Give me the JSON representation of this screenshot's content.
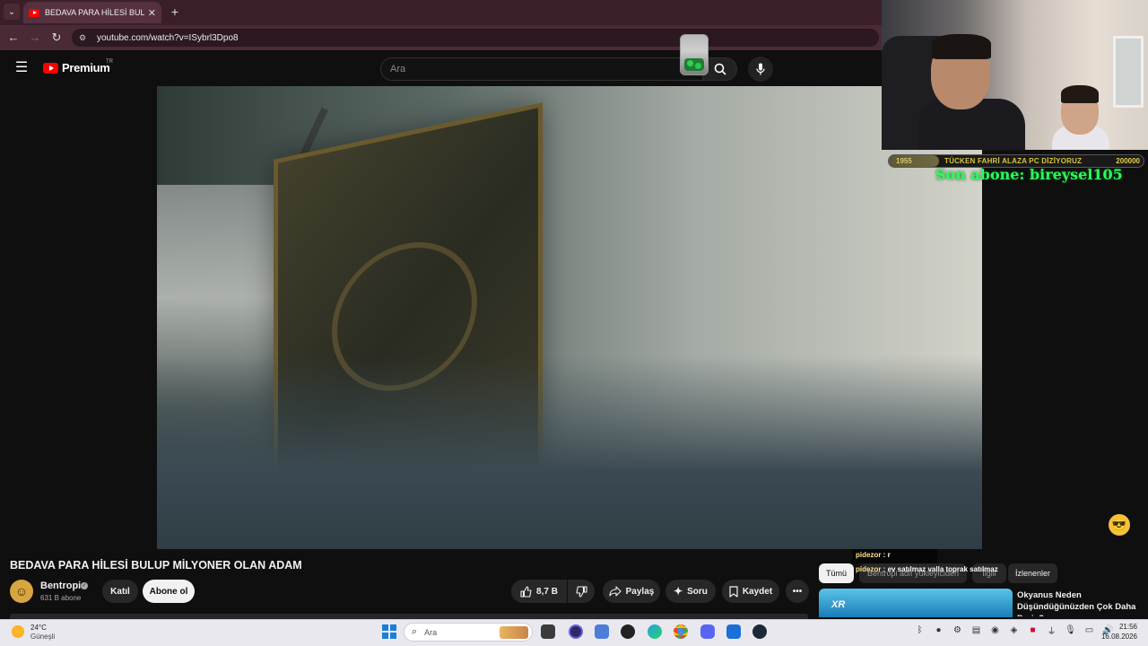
{
  "browser": {
    "tab_title": "BEDAVA PARA HİLESİ BULUP MİLYONER OLAN ADAM",
    "tab_close": "✕",
    "new_tab": "+",
    "url": "youtube.com/watch?v=ISybrl3Dpo8"
  },
  "youtube": {
    "brand": "Premium",
    "country": "TR",
    "search_placeholder": "Ara"
  },
  "video": {
    "title": "BEDAVA PARA HİLESİ BULUP MİLYONER OLAN ADAM",
    "channel": "Bentropi",
    "subscribers": "631 B abone",
    "join_label": "Katıl",
    "subscribe_label": "Abone ol",
    "likes": "8,7 B",
    "share_label": "Paylaş",
    "ask_label": "Soru",
    "save_label": "Kaydet"
  },
  "sidebar": {
    "chips": [
      "Tümü",
      "Bentropi adlı yükleyiciden",
      "İlgili",
      "İzlenenler"
    ],
    "recommendation": {
      "badge": "XR",
      "title": "Okyanus Neden Düşündüğünüzden Çok Daha Derin?"
    }
  },
  "stream": {
    "goal_current": "1955",
    "goal_label": "TÜCKEN FAHRİ ALAZA PC DİZİYORUZ",
    "goal_target": "200000",
    "goal_progress": 0.01,
    "last_sub": "Son abone: bireysel105",
    "chat": [
      {
        "user": "pidezor",
        "text": "r"
      },
      {
        "user": "pidezor",
        "text": "ev satılmaz valla toprak satılmaz"
      }
    ]
  },
  "taskbar": {
    "weather_temp": "24°C",
    "weather_desc": "Güneşli",
    "search_placeholder": "Ara",
    "time": "21:56",
    "date": "16.08.2026"
  },
  "colors": {
    "accent_red": "#ff0000",
    "last_sub_green": "#2bff5a",
    "goal_yellow": "#d8c63a"
  },
  "icons": [
    "chevron-down-icon",
    "youtube-icon",
    "back-icon",
    "forward-icon",
    "reload-icon",
    "site-settings-icon",
    "menu-icon",
    "search-icon",
    "mic-icon",
    "like-icon",
    "dislike-icon",
    "share-icon",
    "sparkle-icon",
    "bookmark-icon",
    "more-icon",
    "windows-start-icon"
  ]
}
